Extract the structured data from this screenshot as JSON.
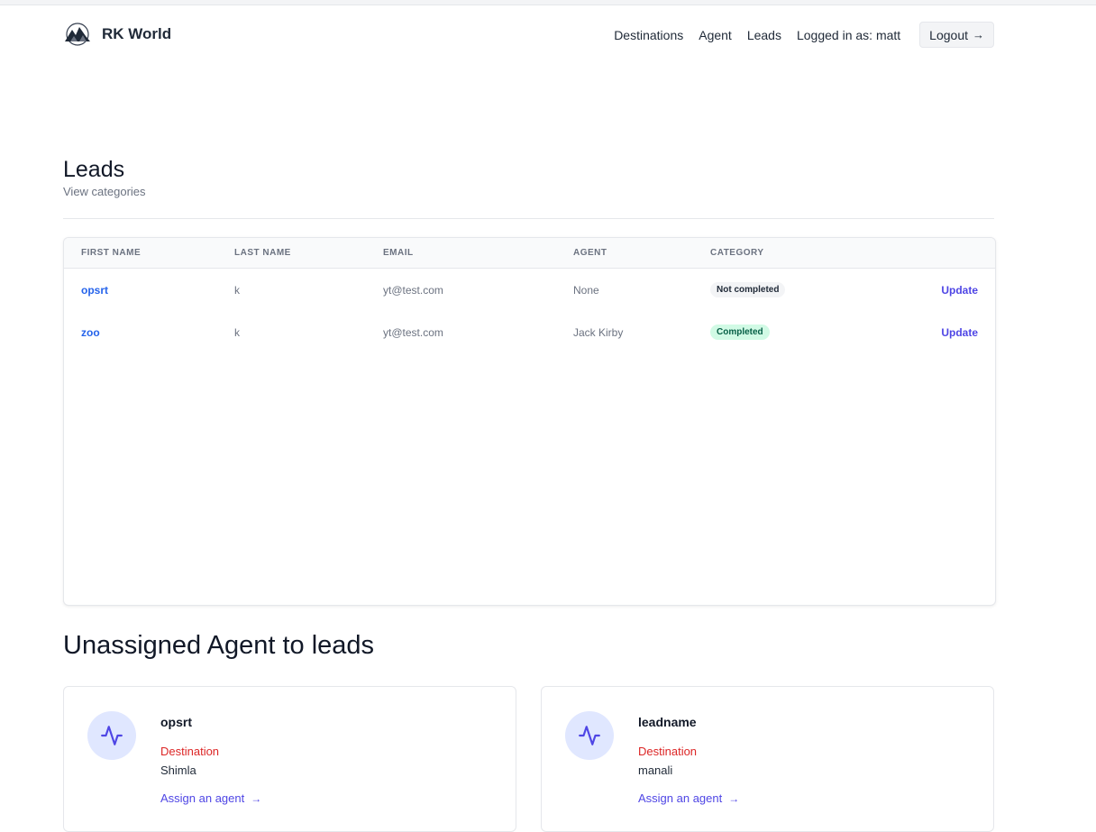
{
  "app": {
    "brand": "RK World",
    "logo_icon": "mountain-logo-icon"
  },
  "nav": {
    "links": [
      "Destinations",
      "Agent",
      "Leads"
    ],
    "user_text": "Logged in as: matt",
    "logout_label": "Logout",
    "logout_icon": "arrow-right-icon"
  },
  "page": {
    "title": "Leads",
    "subtitle": "View categories"
  },
  "table": {
    "headers": [
      "First name",
      "Last name",
      "Email",
      "Agent",
      "Category"
    ],
    "rows": [
      {
        "first_name": "opsrt",
        "last_name": "k",
        "email": "yt@test.com",
        "agent": "None",
        "category": "Not completed",
        "action": "Update"
      },
      {
        "first_name": "zoo",
        "last_name": "k",
        "email": "yt@test.com",
        "agent": "Jack Kirby",
        "category": "Completed",
        "action": "Update"
      }
    ]
  },
  "unassigned": {
    "title": "Unassigned Agent to leads",
    "cards": [
      {
        "name": "opsrt",
        "label": "Destination",
        "destination": "Shimla",
        "link": "Assign an agent",
        "icon": "activity-icon"
      },
      {
        "name": "leadname",
        "label": "Destination",
        "destination": "manali",
        "link": "Assign an agent",
        "icon": "activity-icon"
      }
    ]
  },
  "colors": {
    "accent": "#4f46e5",
    "link": "#2563eb",
    "destination_label": "#dc2626",
    "icon_bg": "#e0e7ff",
    "completed_bg": "#d1fae5"
  }
}
